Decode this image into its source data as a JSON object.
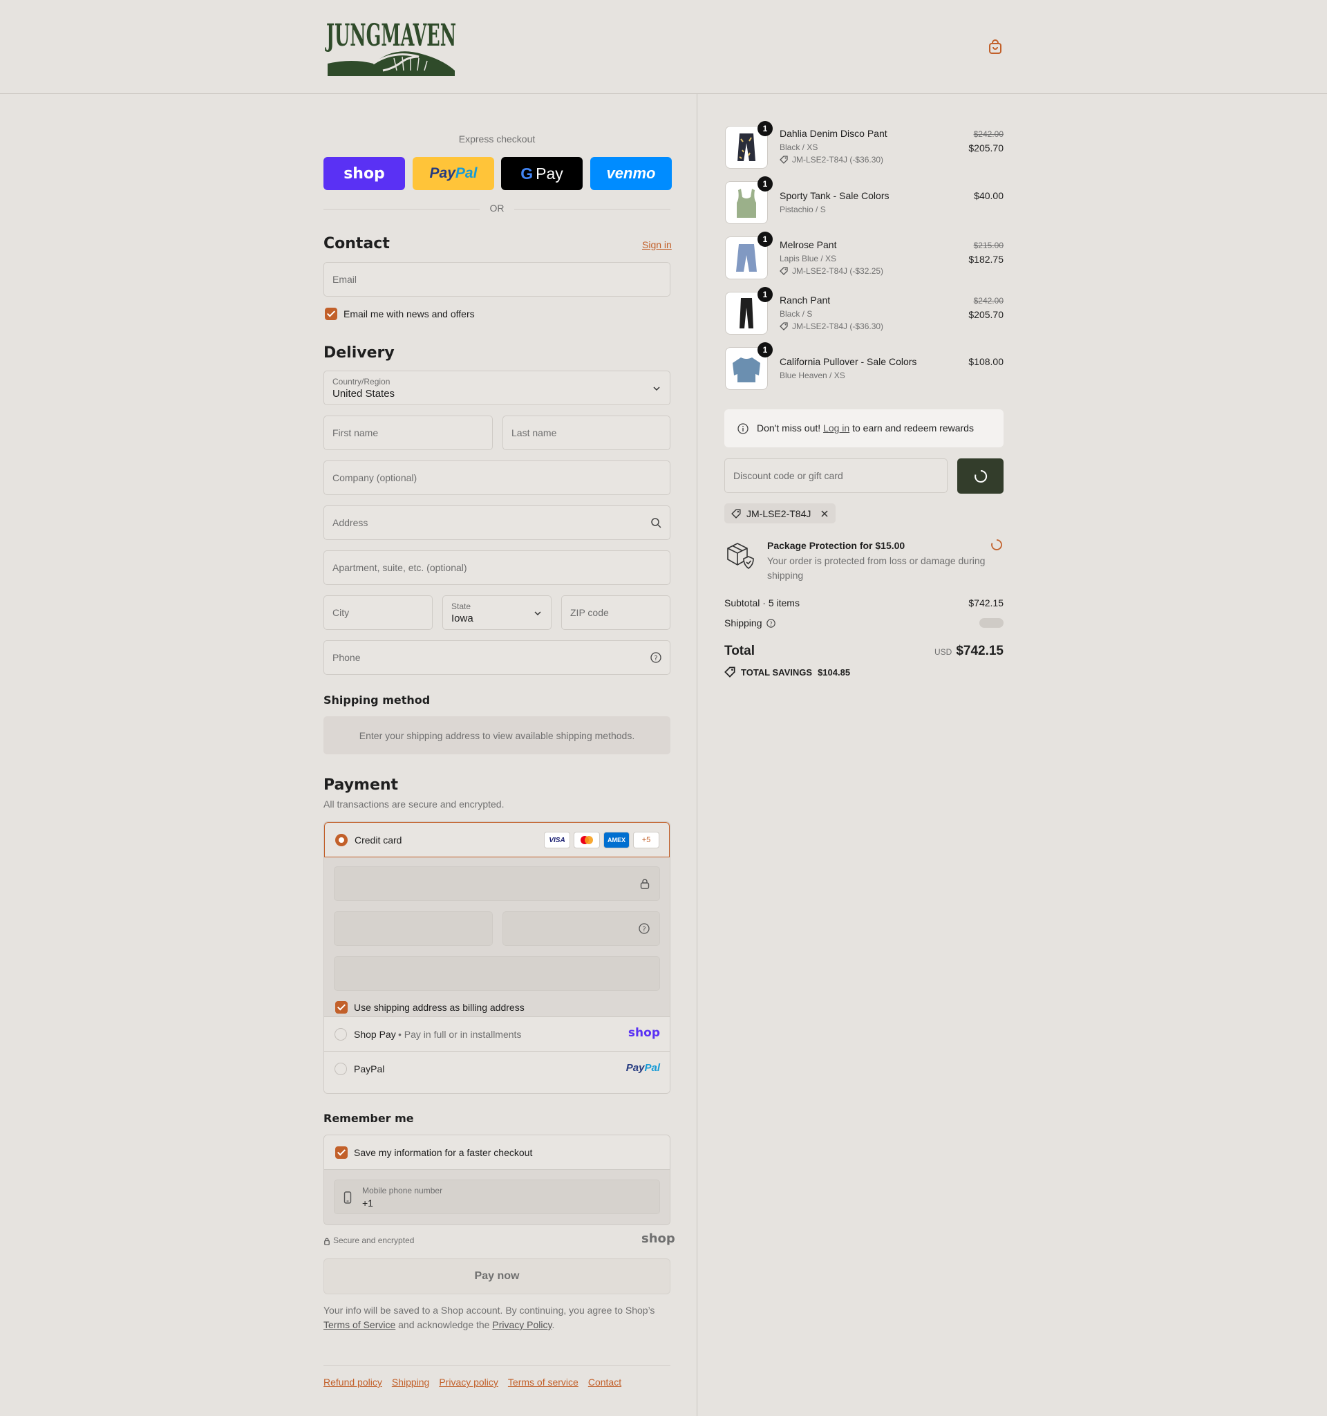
{
  "brand": {
    "name": "JUNGMAVEN",
    "accent": "#c2602a",
    "logo_color": "#2f4b2a"
  },
  "express": {
    "title": "Express checkout",
    "or": "OR",
    "buttons": [
      "shop",
      "PayPal",
      "G Pay",
      "venmo"
    ]
  },
  "contact": {
    "title": "Contact",
    "signin": "Sign in",
    "email_placeholder": "Email",
    "news_label": "Email me with news and offers"
  },
  "delivery": {
    "title": "Delivery",
    "country_label": "Country/Region",
    "country_value": "United States",
    "first_name": "First name",
    "last_name": "Last name",
    "company": "Company (optional)",
    "address": "Address",
    "apartment": "Apartment, suite, etc. (optional)",
    "city": "City",
    "state_label": "State",
    "state_value": "Iowa",
    "zip": "ZIP code",
    "phone": "Phone"
  },
  "shipping_method": {
    "title": "Shipping method",
    "notice": "Enter your shipping address to view available shipping methods."
  },
  "payment": {
    "title": "Payment",
    "subtitle": "All transactions are secure and encrypted.",
    "credit_card": "Credit card",
    "card_badges": [
      "VISA",
      "MC",
      "AMEX",
      "+5"
    ],
    "billing_label": "Use shipping address as billing address",
    "shop_pay": "Shop Pay",
    "shop_pay_note": "Pay in full or in installments",
    "shop_logo": "shop",
    "paypal": "PayPal"
  },
  "remember": {
    "title": "Remember me",
    "save_label": "Save my information for a faster checkout",
    "mobile_label": "Mobile phone number",
    "mobile_value": "+1",
    "secure": "Secure and encrypted",
    "shop_logo": "shop"
  },
  "pay_now": "Pay now",
  "legal": {
    "pre": "Your info will be saved to a Shop account. By continuing, you agree to Shop’s",
    "tos": "Terms of Service",
    "mid": "and acknowledge the",
    "privacy": "Privacy Policy",
    "end": "."
  },
  "footer_links": [
    "Refund policy",
    "Shipping",
    "Privacy policy",
    "Terms of service",
    "Contact"
  ],
  "cart": {
    "items": [
      {
        "qty": "1",
        "name": "Dahlia Denim Disco Pant",
        "variant": "Black / XS",
        "discount": "JM-LSE2-T84J (-$36.30)",
        "old_price": "$242.00",
        "price": "$205.70"
      },
      {
        "qty": "1",
        "name": "Sporty Tank - Sale Colors",
        "variant": "Pistachio / S",
        "price": "$40.00"
      },
      {
        "qty": "1",
        "name": "Melrose Pant",
        "variant": "Lapis Blue / XS",
        "discount": "JM-LSE2-T84J (-$32.25)",
        "old_price": "$215.00",
        "price": "$182.75"
      },
      {
        "qty": "1",
        "name": "Ranch Pant",
        "variant": "Black / S",
        "discount": "JM-LSE2-T84J (-$36.30)",
        "old_price": "$242.00",
        "price": "$205.70"
      },
      {
        "qty": "1",
        "name": "California Pullover - Sale Colors",
        "variant": "Blue Heaven / XS",
        "price": "$108.00"
      }
    ],
    "rewards": {
      "pre": "Don't miss out!",
      "link": "Log in",
      "post": "to earn and redeem rewards"
    },
    "discount_placeholder": "Discount code or gift card",
    "applied_code": "JM-LSE2-T84J",
    "protection": {
      "title": "Package Protection for $15.00",
      "desc": "Your order is protected from loss or damage during shipping"
    },
    "subtotal_label": "Subtotal · 5 items",
    "subtotal": "$742.15",
    "shipping_label": "Shipping",
    "total_label": "Total",
    "currency": "USD",
    "total": "$742.15",
    "savings_label": "TOTAL SAVINGS",
    "savings": "$104.85"
  }
}
